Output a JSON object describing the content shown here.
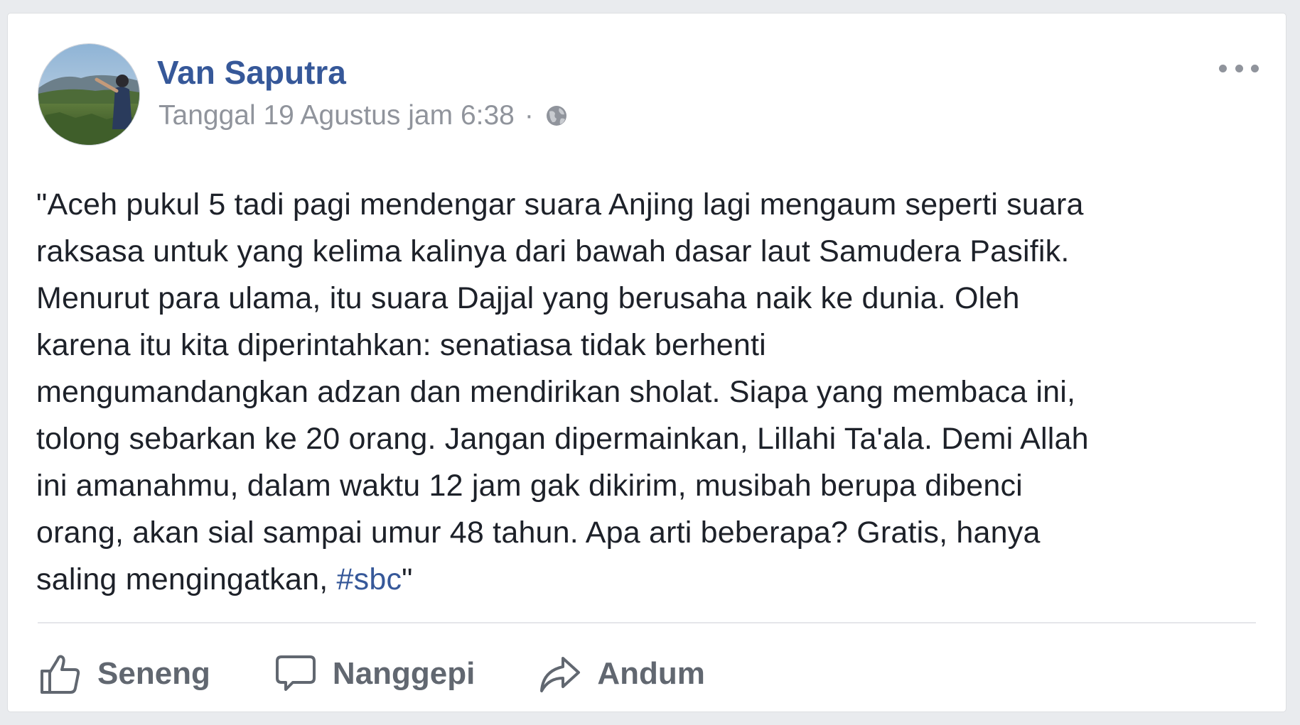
{
  "post": {
    "author": "Van Saputra",
    "timestamp": "Tanggal 19 Agustus jam 6:38",
    "separator": "·",
    "privacy_icon": "globe-icon",
    "more_icon": "more-options-icon",
    "lines": [
      "\"Aceh pukul 5 tadi pagi mendengar suara Anjing lagi mengaum seperti suara",
      "raksasa untuk yang kelima kalinya dari bawah dasar laut Samudera Pasifik.",
      "Menurut para ulama, itu suara Dajjal yang berusaha naik ke dunia. Oleh",
      "karena itu kita diperintahkan: senatiasa tidak berhenti",
      "mengumandangkan adzan dan mendirikan sholat. Siapa yang membaca ini,",
      "tolong sebarkan ke 20 orang. Jangan dipermainkan, Lillahi Ta'ala. Demi Allah",
      "ini amanahmu, dalam waktu 12 jam gak dikirim, musibah berupa dibenci",
      "orang, akan sial sampai umur 48 tahun. Apa arti beberapa? Gratis, hanya"
    ],
    "last_line_prefix": "saling mengingatkan, ",
    "hashtag": "#sbc",
    "last_line_suffix": "\""
  },
  "actions": {
    "like_label": "Seneng",
    "comment_label": "Nanggepi",
    "share_label": "Andum"
  },
  "colors": {
    "link": "#365899",
    "meta": "#90949c",
    "text": "#1d2129",
    "action": "#616770"
  }
}
